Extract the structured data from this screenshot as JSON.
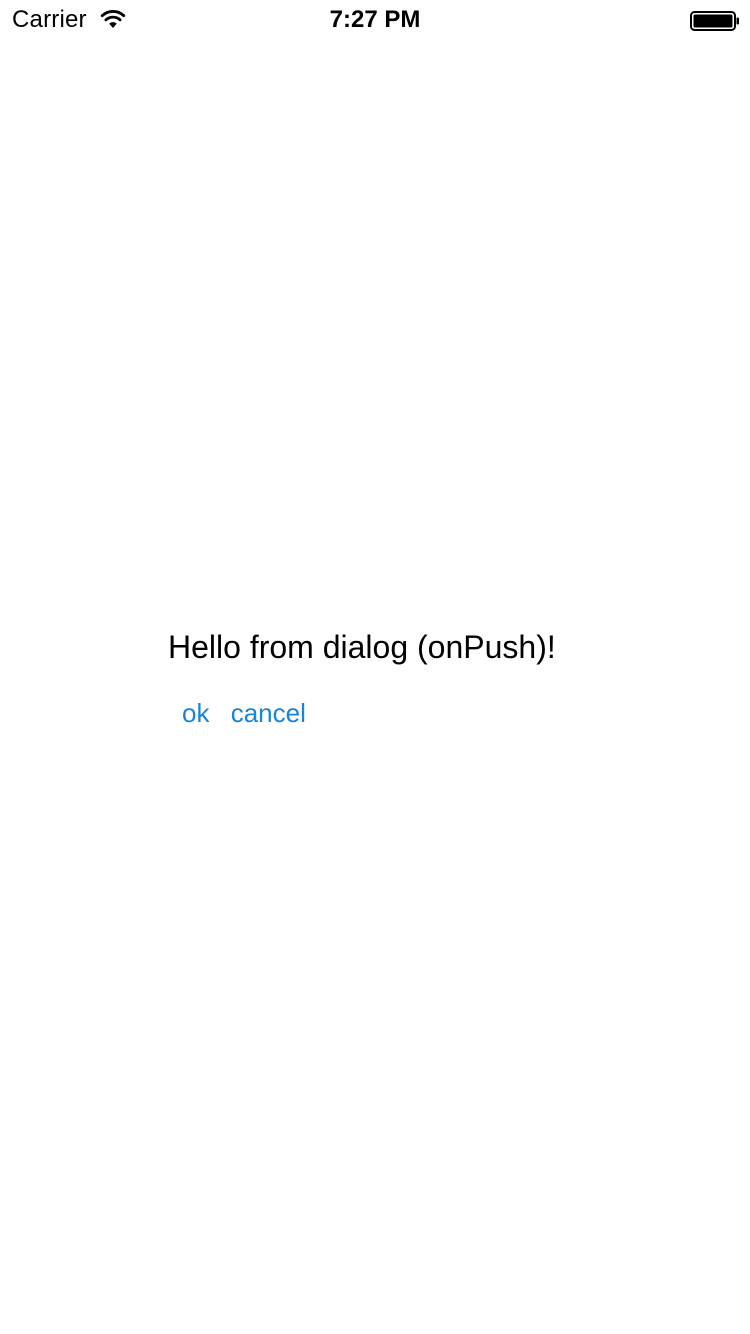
{
  "status_bar": {
    "carrier": "Carrier",
    "time": "7:27 PM",
    "wifi_icon": "wifi-icon",
    "battery_icon": "battery-full-icon"
  },
  "dialog": {
    "message": "Hello from dialog (onPush)!",
    "ok_label": "ok",
    "cancel_label": "cancel"
  },
  "colors": {
    "link": "#1a84d6",
    "text": "#000000",
    "background": "#ffffff"
  }
}
